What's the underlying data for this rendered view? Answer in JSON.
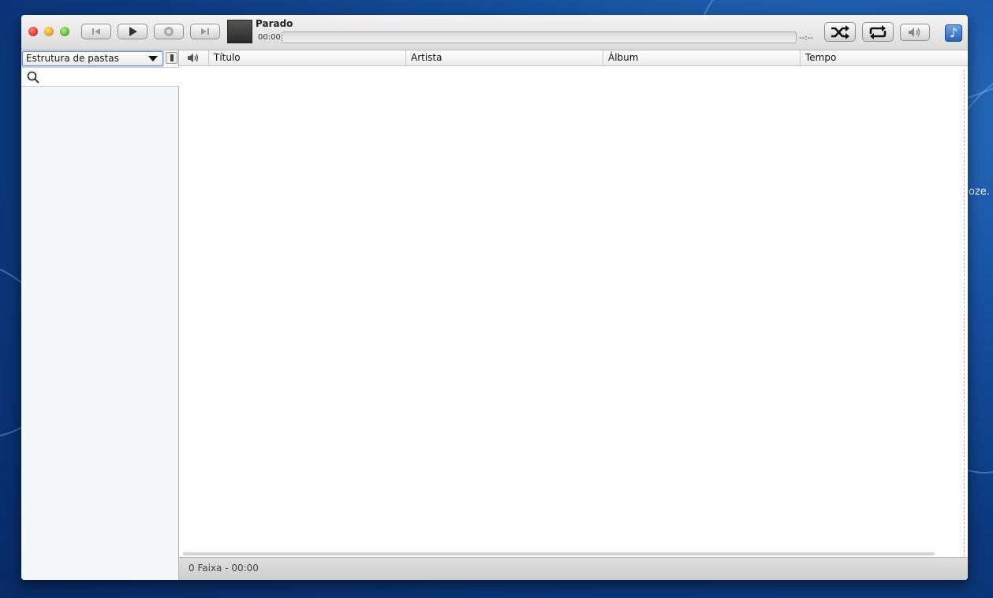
{
  "player": {
    "state_label": "Parado",
    "time_elapsed": "00:00",
    "time_remaining": "--:--",
    "progress": 0
  },
  "toolbar": {
    "previous_icon": "previous-icon",
    "play_icon": "play-icon",
    "stop_icon": "stop-icon",
    "next_icon": "next-icon",
    "shuffle_icon": "shuffle-icon",
    "repeat_icon": "repeat-icon",
    "volume_icon": "volume-icon"
  },
  "sidebar": {
    "view_selected": "Estrutura de pastas",
    "search_placeholder": ""
  },
  "tracklist": {
    "columns": [
      "Título",
      "Artista",
      "Álbum",
      "Tempo"
    ],
    "rows": []
  },
  "statusbar": {
    "summary": "0 Faixa - 00:00"
  },
  "desktop": {
    "partial_text": "oze."
  },
  "colors": {
    "desktop_blue": "#1650a0",
    "window_bg": "#ececec",
    "close": "#e0362c",
    "minimize": "#e5a51c",
    "maximize": "#5fb832"
  }
}
